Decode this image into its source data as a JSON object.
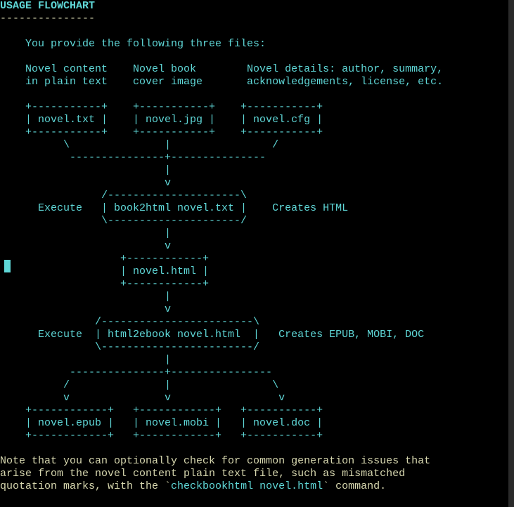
{
  "title": "USAGE FLOWCHART",
  "separator": "---------------",
  "diagram": "    You provide the following three files:\n\n    Novel content    Novel book        Novel details: author, summary,\n    in plain text    cover image       acknowledgements, license, etc.\n\n    +-----------+    +-----------+    +-----------+\n    | novel.txt |    | novel.jpg |    | novel.cfg |\n    +-----------+    +-----------+    +-----------+\n          \\               |                /\n           ---------------+---------------\n                          |\n                          v\n                /---------------------\\\n      Execute   | book2html novel.txt |    Creates HTML\n                \\---------------------/\n                          |\n                          v\n                   +------------+\n                   | novel.html |\n                   +------------+\n                          |\n                          v\n               /------------------------\\\n      Execute  | html2ebook novel.html  |   Creates EPUB, MOBI, DOC\n               \\------------------------/\n                          |\n           ---------------+----------------\n          /               |                \\\n          v               v                 v\n    +------------+   +------------+   +-----------+\n    | novel.epub |   | novel.mobi |   | novel.doc |\n    +------------+   +------------+   +-----------+",
  "note_part1": "Note that you can optionally check for common generation issues that\narise from the novel content plain text file, such as mismatched\nquotation marks, with the `",
  "note_cmd": "checkbookhtml novel.html",
  "note_part2": "` command."
}
